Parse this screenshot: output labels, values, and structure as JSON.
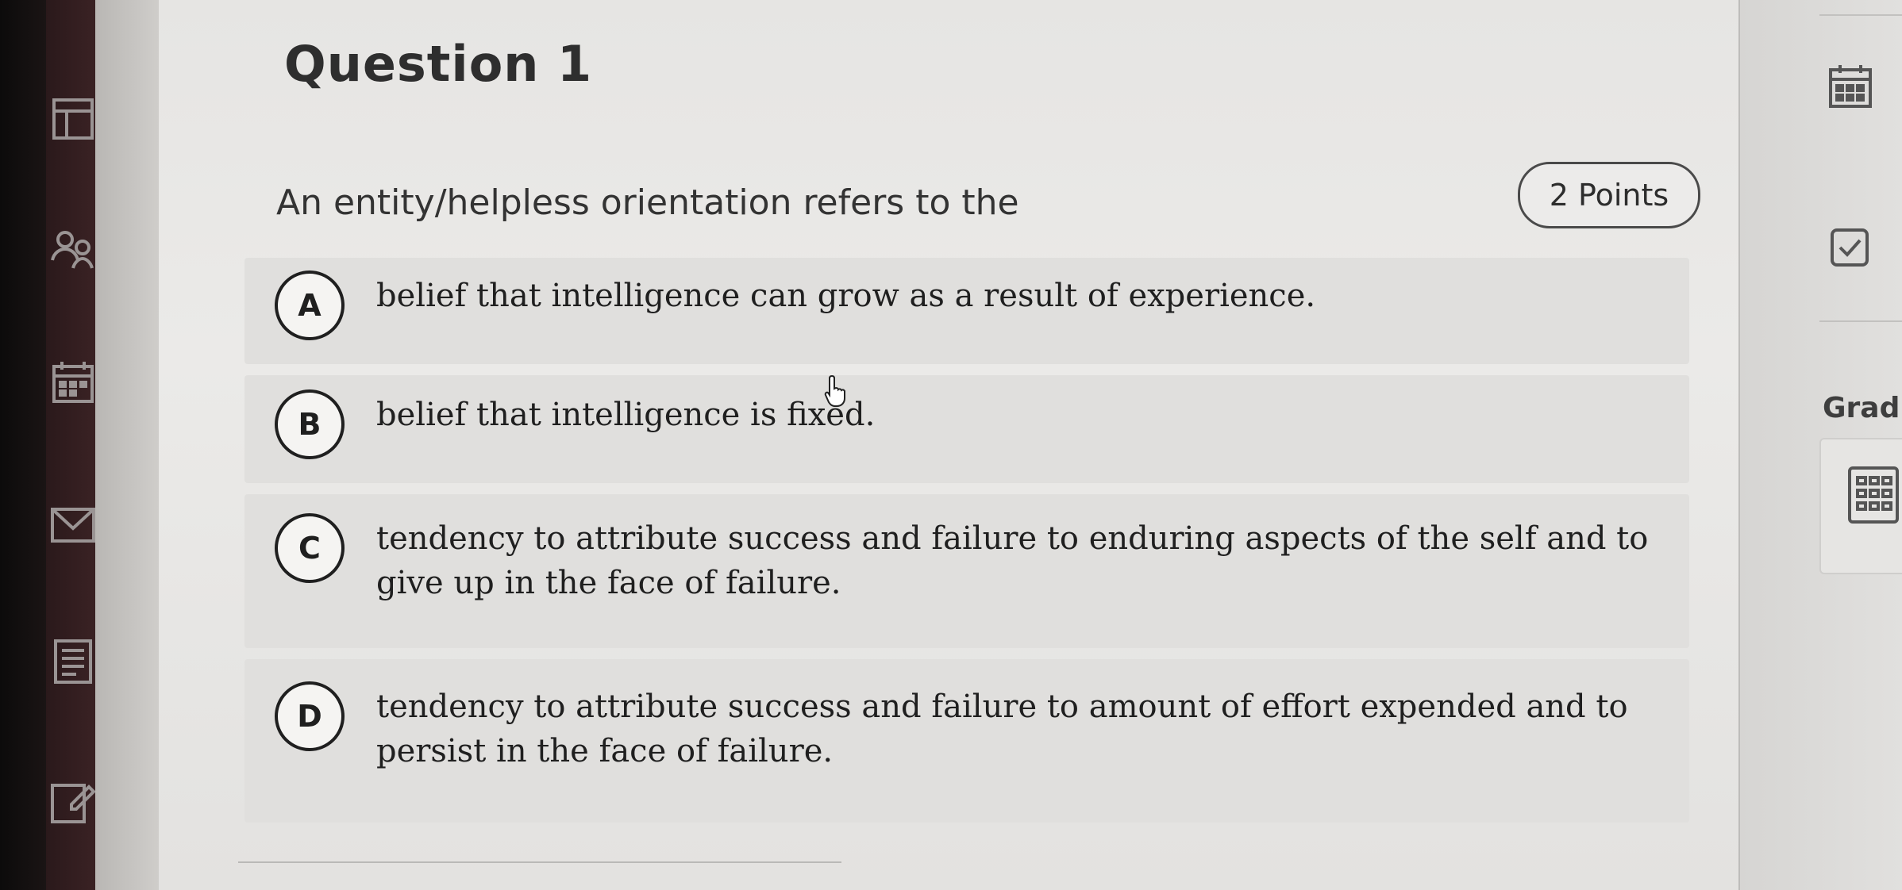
{
  "question": {
    "title": "Question 1",
    "points": "2 Points",
    "prompt": "An entity/helpless orientation refers to the"
  },
  "options": [
    {
      "letter": "A",
      "text": "belief that intelligence can grow as a result of experience."
    },
    {
      "letter": "B",
      "text": "belief that intelligence is fixed."
    },
    {
      "letter": "C",
      "text": "tendency to attribute success and failure to enduring aspects of the self and to give up in the face of failure."
    },
    {
      "letter": "D",
      "text": "tendency to attribute success and failure to amount of effort expended and to persist in the face of failure."
    }
  ],
  "right_rail": {
    "grading_label": "Gradi"
  },
  "icons": {
    "nav": [
      "dashboard-icon",
      "people-icon",
      "calendar-icon",
      "mail-icon",
      "document-icon",
      "edit-icon"
    ],
    "right": [
      "calendar-icon",
      "checkbox-icon",
      "grid-icon"
    ]
  }
}
